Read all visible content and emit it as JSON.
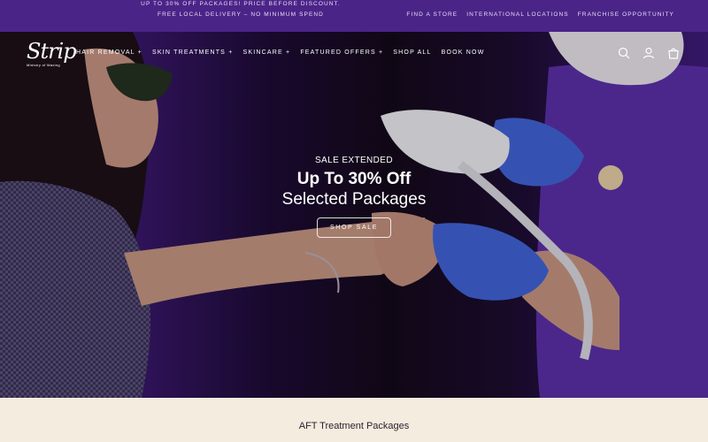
{
  "announcement": {
    "line1": "UP TO 30% OFF PACKAGES! PRICE BEFORE DISCOUNT.",
    "line2": "FREE LOCAL DELIVERY – NO MINIMUM SPEND",
    "links": [
      "FIND A STORE",
      "INTERNATIONAL LOCATIONS",
      "FRANCHISE OPPORTUNITY"
    ]
  },
  "brand": {
    "logo_text": "Strip",
    "tagline": "Ministry of Waxing"
  },
  "nav": {
    "items": [
      "HAIR REMOVAL +",
      "SKIN TREATMENTS +",
      "SKINCARE +",
      "FEATURED OFFERS +",
      "SHOP ALL",
      "BOOK NOW"
    ],
    "icons": [
      "search-icon",
      "account-icon",
      "cart-icon"
    ]
  },
  "hero": {
    "eyebrow": "SALE EXTENDED",
    "headline": "Up To 30% Off",
    "subline": "Selected Packages",
    "cta": "SHOP SALE"
  },
  "section": {
    "title": "AFT Treatment Packages"
  },
  "colors": {
    "announcement_bg": "#4b2488",
    "section_bg": "#f3ecdf",
    "uniform": "#5a2fa8",
    "glove": "#3f63d6"
  }
}
